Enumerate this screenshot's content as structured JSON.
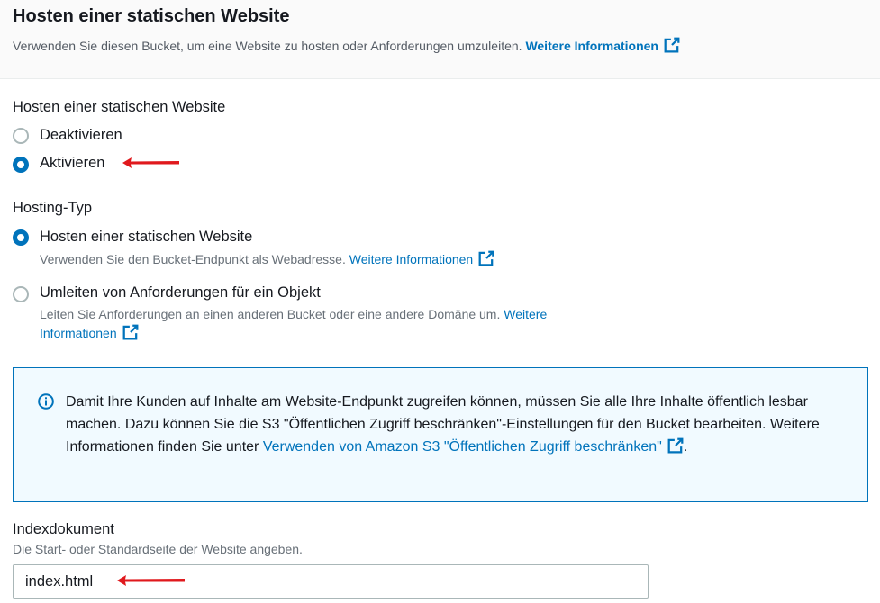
{
  "header": {
    "title": "Hosten einer statischen Website",
    "description": "Verwenden Sie diesen Bucket, um eine Website zu hosten oder Anforderungen umzuleiten.",
    "link": "Weitere Informationen"
  },
  "static_hosting": {
    "label": "Hosten einer statischen Website",
    "options": [
      {
        "label": "Deaktivieren",
        "checked": false
      },
      {
        "label": "Aktivieren",
        "checked": true
      }
    ]
  },
  "hosting_type": {
    "label": "Hosting-Typ",
    "options": [
      {
        "label": "Hosten einer statischen Website",
        "description": "Verwenden Sie den Bucket-Endpunkt als Webadresse.",
        "link": "Weitere Informationen",
        "checked": true
      },
      {
        "label": "Umleiten von Anforderungen für ein Objekt",
        "description": "Leiten Sie Anforderungen an einen anderen Bucket oder eine andere Domäne um.",
        "link_line1": "Weitere",
        "link_line2": "Informationen",
        "checked": false
      }
    ]
  },
  "info": {
    "text": "Damit Ihre Kunden auf Inhalte am Website-Endpunkt zugreifen können, müssen Sie alle Ihre Inhalte öffentlich lesbar machen. Dazu können Sie die S3 \"Öffentlichen Zugriff beschränken\"-Einstellungen für den Bucket bearbeiten. Weitere Informationen finden Sie unter",
    "link": "Verwenden von Amazon S3 \"Öffentlichen Zugriff beschränken\"",
    "suffix": "."
  },
  "index_document": {
    "label": "Indexdokument",
    "description": "Die Start- oder Standardseite der Website angeben.",
    "value": "index.html"
  },
  "colors": {
    "accent": "#0073bb",
    "annotation_arrow": "#e0191d"
  },
  "icons": [
    "external-link-icon",
    "info-icon",
    "annotation-arrow"
  ]
}
